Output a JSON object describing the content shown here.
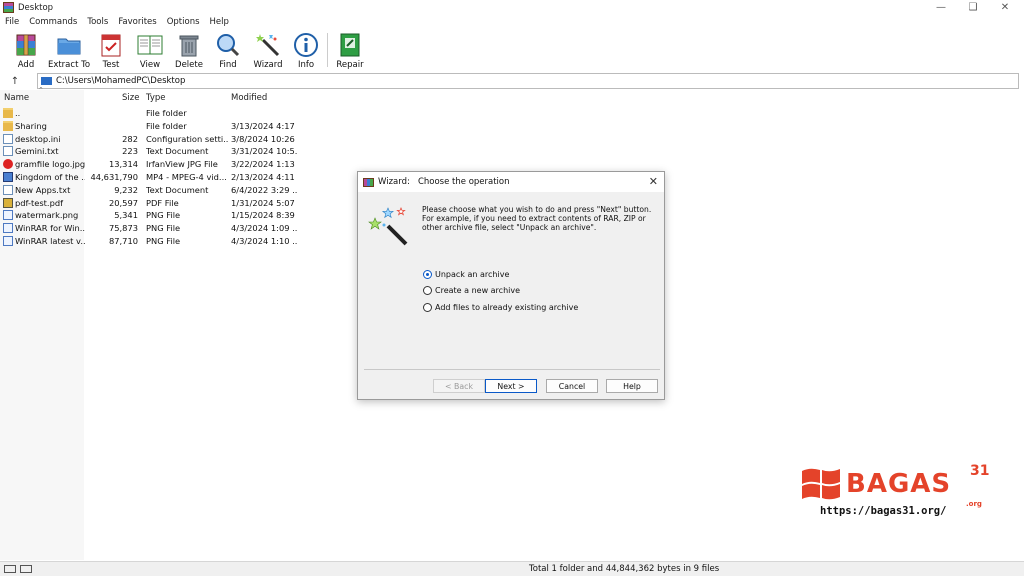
{
  "window": {
    "title": "Desktop"
  },
  "menu": [
    "File",
    "Commands",
    "Tools",
    "Favorites",
    "Options",
    "Help"
  ],
  "toolbar": [
    {
      "label": "Add",
      "icon": "add-archive-icon"
    },
    {
      "label": "Extract To",
      "icon": "extract-folder-icon"
    },
    {
      "label": "Test",
      "icon": "test-icon"
    },
    {
      "label": "View",
      "icon": "view-book-icon"
    },
    {
      "label": "Delete",
      "icon": "trash-icon"
    },
    {
      "label": "Find",
      "icon": "magnifier-icon"
    },
    {
      "label": "Wizard",
      "icon": "wand-icon"
    },
    {
      "label": "Info",
      "icon": "info-icon"
    },
    {
      "label": "Repair",
      "icon": "repair-kit-icon"
    }
  ],
  "path": "C:\\Users\\MohamedPC\\Desktop",
  "columns": {
    "name": "Name",
    "size": "Size",
    "type": "Type",
    "modified": "Modified"
  },
  "files": [
    {
      "name": "..",
      "size": "",
      "type": "File folder",
      "modified": "",
      "icon": "folder"
    },
    {
      "name": "Sharing",
      "size": "",
      "type": "File folder",
      "modified": "3/13/2024 4:17 ...",
      "icon": "folder"
    },
    {
      "name": "desktop.ini",
      "size": "282",
      "type": "Configuration setti...",
      "modified": "3/8/2024 10:26 ...",
      "icon": "doc"
    },
    {
      "name": "Gemini.txt",
      "size": "223",
      "type": "Text Document",
      "modified": "3/31/2024 10:5...",
      "icon": "doc"
    },
    {
      "name": "gramfile logo.jpg",
      "size": "13,314",
      "type": "IrfanView JPG File",
      "modified": "3/22/2024 1:13 ...",
      "icon": "jpg"
    },
    {
      "name": "Kingdom of the ...",
      "size": "44,631,790",
      "type": "MP4 - MPEG-4 vid...",
      "modified": "2/13/2024 4:11 ...",
      "icon": "mp4"
    },
    {
      "name": "New Apps.txt",
      "size": "9,232",
      "type": "Text Document",
      "modified": "6/4/2022 3:29 ...",
      "icon": "doc"
    },
    {
      "name": "pdf-test.pdf",
      "size": "20,597",
      "type": "PDF File",
      "modified": "1/31/2024 5:07 ...",
      "icon": "pdf"
    },
    {
      "name": "watermark.png",
      "size": "5,341",
      "type": "PNG File",
      "modified": "1/15/2024 8:39 ...",
      "icon": "png"
    },
    {
      "name": "WinRAR for Win...",
      "size": "75,873",
      "type": "PNG File",
      "modified": "4/3/2024 1:09 ...",
      "icon": "png"
    },
    {
      "name": "WinRAR latest v...",
      "size": "87,710",
      "type": "PNG File",
      "modified": "4/3/2024 1:10 ...",
      "icon": "png"
    }
  ],
  "status": {
    "text": "Total 1 folder and 44,844,362 bytes in 9 files"
  },
  "dialog": {
    "title": "Wizard:   Choose the operation",
    "description": "Please choose what you wish to do and press \"Next\" button.\nFor example, if you need to extract contents of RAR, ZIP or other archive file, select \"Unpack an archive\".",
    "options": [
      {
        "label": "Unpack an archive",
        "selected": true
      },
      {
        "label": "Create a new archive",
        "selected": false
      },
      {
        "label": "Add files to already existing archive",
        "selected": false
      }
    ],
    "buttons": {
      "back": "< Back",
      "next": "Next >",
      "cancel": "Cancel",
      "help": "Help"
    }
  },
  "watermark": {
    "brand": "BAGAS",
    "number": "31",
    "org": ".org",
    "url": "https://bagas31.org/"
  },
  "colors": {
    "accent": "#0a59c8",
    "watermark": "#e4432a",
    "folder": "#e8b84a"
  }
}
